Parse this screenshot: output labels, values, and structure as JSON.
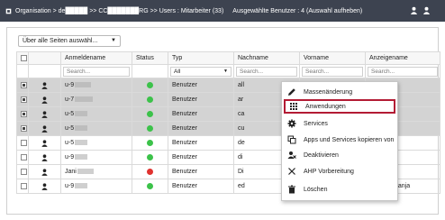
{
  "header": {
    "breadcrumb": "Organisation > de█████ >> CC███████RG >> Users : Mitarbeiter (33)",
    "selection_info": "Ausgewählte Benutzer : 4 (Auswahl aufheben)"
  },
  "filter": {
    "value": "Über alle Seiten auswähl..."
  },
  "table": {
    "columns": [
      "Anmeldename",
      "Status",
      "Typ",
      "Nachname",
      "Vorname",
      "Anzeigename"
    ],
    "search_placeholder": "Search...",
    "type_filter": "All",
    "rows": [
      {
        "login": "u-9",
        "status": "green",
        "type": "Benutzer",
        "lastname": "all",
        "firstname": "",
        "display": "",
        "selected": true
      },
      {
        "login": "u-7",
        "status": "green",
        "type": "Benutzer",
        "lastname": "ar",
        "firstname": "",
        "display": "",
        "selected": true
      },
      {
        "login": "u-5",
        "status": "green",
        "type": "Benutzer",
        "lastname": "ca",
        "firstname": "",
        "display": "",
        "selected": true
      },
      {
        "login": "u-5",
        "status": "green",
        "type": "Benutzer",
        "lastname": "cu",
        "firstname": "",
        "display": "",
        "selected": true
      },
      {
        "login": "u-5",
        "status": "green",
        "type": "Benutzer",
        "lastname": "de",
        "firstname": "",
        "display": "",
        "selected": false
      },
      {
        "login": "u-9",
        "status": "green",
        "type": "Benutzer",
        "lastname": "di",
        "firstname": "",
        "display": "",
        "selected": false
      },
      {
        "login": "Jani",
        "status": "red",
        "type": "Benutzer",
        "lastname": "Di",
        "firstname": "",
        "display": "",
        "selected": false
      },
      {
        "login": "u-9",
        "status": "green",
        "type": "Benutzer",
        "lastname": "ed",
        "firstname": "anja",
        "display": "edlellmen anja",
        "selected": false
      }
    ]
  },
  "context_menu": {
    "items": [
      {
        "label": "Massenänderung",
        "icon": "pencil-icon"
      },
      {
        "label": "Anwendungen",
        "icon": "grid-icon",
        "highlighted": true
      },
      {
        "label": "Services",
        "icon": "gear-icon"
      },
      {
        "label": "Apps und Services kopieren von",
        "icon": "copy-icon"
      },
      {
        "label": "Deaktivieren",
        "icon": "deactivate-icon"
      },
      {
        "label": "AHP Vorbereitung",
        "icon": "tools-icon"
      },
      {
        "label": "Löschen",
        "icon": "trash-icon"
      }
    ]
  },
  "colors": {
    "header_bg": "#3d4350",
    "status_green": "#3cc24a",
    "status_red": "#e0322f",
    "highlight_border": "#b31b34",
    "selected_row": "#d3d3d3"
  }
}
